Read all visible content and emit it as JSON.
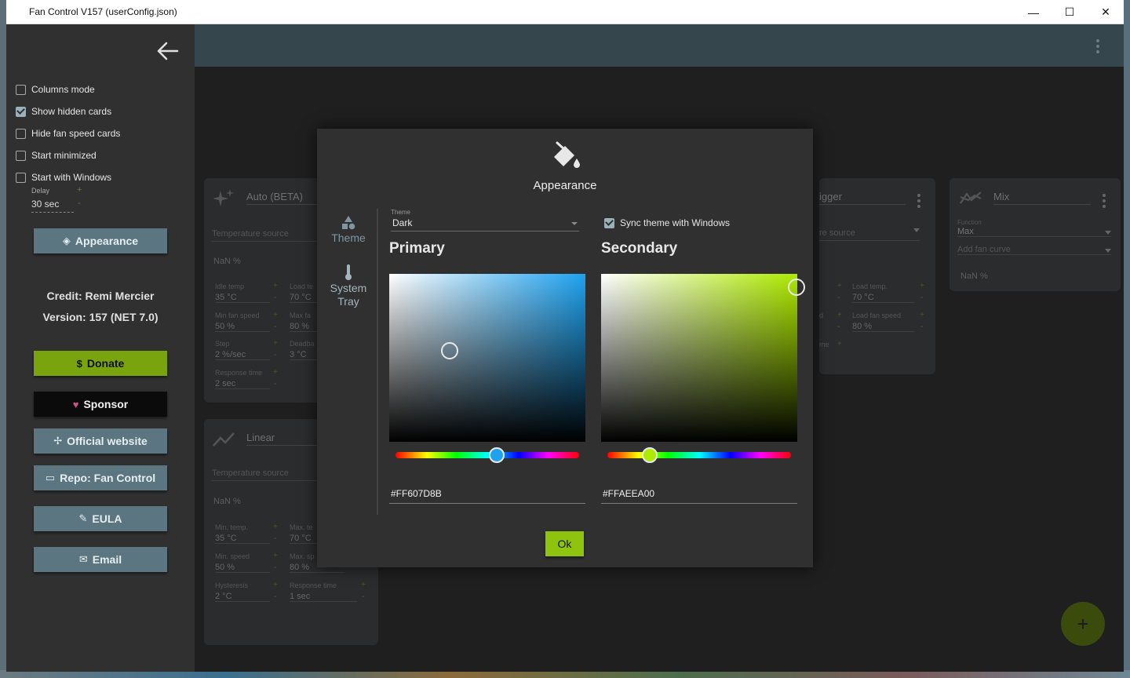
{
  "window": {
    "title": "Fan Control V157 (userConfig.json)",
    "controls": {
      "minimize": "—",
      "maximize": "☐",
      "close": "✕"
    }
  },
  "sidebar": {
    "options": [
      {
        "label": "Columns mode",
        "checked": false
      },
      {
        "label": "Show hidden cards",
        "checked": true
      },
      {
        "label": "Hide fan speed cards",
        "checked": false
      },
      {
        "label": "Start minimized",
        "checked": false
      },
      {
        "label": "Start with Windows",
        "checked": false
      }
    ],
    "delay": {
      "label": "Delay",
      "value": "30 sec",
      "plus": "+",
      "minus": "-"
    },
    "appearance_label": "Appearance",
    "credit": "Credit: Remi Mercier",
    "version": "Version: 157 (NET 7.0)",
    "donate_label": "Donate",
    "sponsor_label": "Sponsor",
    "website_label": "Official website",
    "repo_label": "Repo: Fan Control",
    "eula_label": "EULA",
    "email_label": "Email",
    "icons": {
      "donate": "$",
      "sponsor": "♥",
      "website": "✢",
      "repo": "▭",
      "eula": "✎",
      "email": "✉",
      "appearance": "◈"
    }
  },
  "cards": {
    "auto": {
      "title": "Auto (BETA)",
      "temp_source": "Temperature source",
      "nan": "NaN %",
      "idle_temp_label": "Idle temp",
      "idle_temp": "35 °C",
      "load_label": "Load te",
      "load_value": "70 °C",
      "min_fan_label": "Min fan speed",
      "min_fan": "50 %",
      "max_fan_label": "Max fa",
      "max_fan": "80 %",
      "step_label": "Step",
      "step": "2 %/sec",
      "deadband_label": "Deadba",
      "deadband": "3 °C",
      "response_label": "Response time",
      "response": "2 sec"
    },
    "linear": {
      "title": "Linear",
      "temp_source": "Temperature source",
      "nan": "NaN %",
      "min_temp_label": "Min. temp.",
      "min_temp": "35 °C",
      "max_temp_label": "Max. te",
      "max_temp": "70 °C",
      "min_speed_label": "Min. speed",
      "min_speed": "50 %",
      "max_speed_label": "Max. sp",
      "max_speed": "80 %",
      "hysteresis_label": "Hysteresis",
      "hysteresis": "2 °C",
      "response_label": "Response time",
      "response": "1 sec"
    },
    "trigger": {
      "title": "igger",
      "temp_source": "re source",
      "load_temp_label": "Load temp.",
      "load_temp": "70 °C",
      "load_fan_label": "Load fan speed",
      "load_fan": "80 %",
      "idle_label": "d",
      "resp_label": "me"
    },
    "mix": {
      "title": "Mix",
      "function_label": "Function",
      "function_value": "Max",
      "add_curve": "Add fan curve",
      "nan": "NaN %"
    },
    "signs": {
      "plus": "+",
      "minus": "-"
    }
  },
  "dialog": {
    "title": "Appearance",
    "nav": {
      "theme": "Theme",
      "system": "System",
      "tray": "Tray"
    },
    "theme_label": "Theme",
    "theme_value": "Dark",
    "sync_label": "Sync theme with Windows",
    "sync_checked": true,
    "primary": {
      "heading": "Primary",
      "hex": "#FF607D8B",
      "hue_color": "#1ea2f0",
      "hue_fraction": 0.55
    },
    "secondary": {
      "heading": "Secondary",
      "hex": "#FFAEEA00",
      "hue_color": "#aeea00",
      "hue_fraction": 0.23
    },
    "ok_label": "Ok"
  },
  "fab_label": "+"
}
